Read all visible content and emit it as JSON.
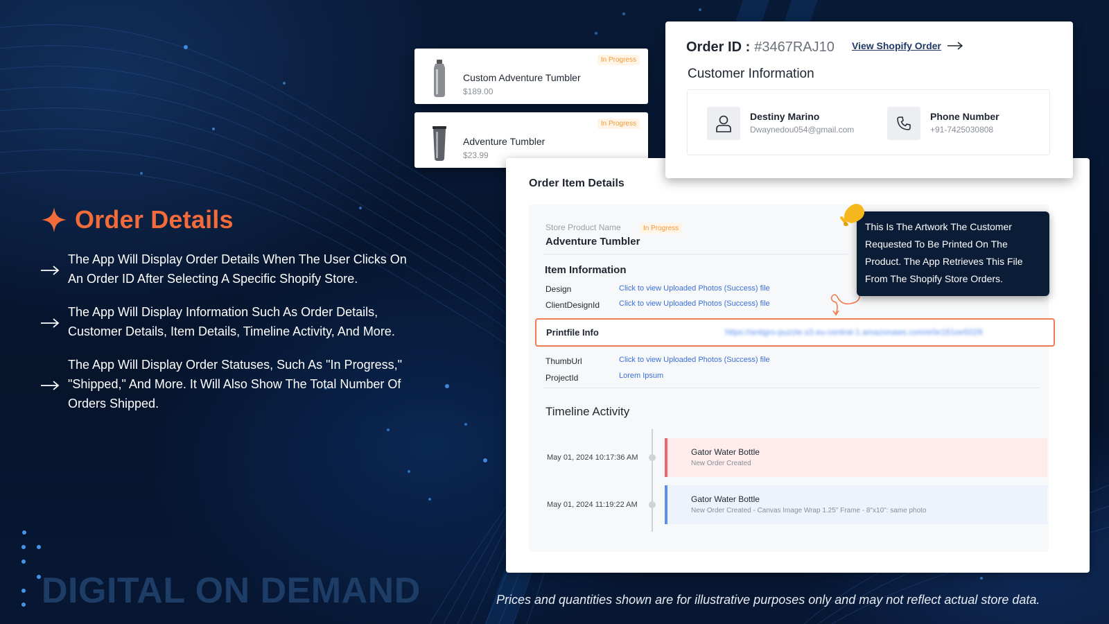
{
  "left_panel": {
    "title": "Order Details",
    "bullets": [
      "The App Will Display Order Details When The User Clicks On An Order ID After Selecting A Specific Shopify Store.",
      "The App Will Display Information Such As Order Details, Customer Details, Item Details, Timeline Activity, And More.",
      "The App Will Display Order Statuses, Such As \"In Progress,\" \"Shipped,\" And More. It Will Also Show The Total Number Of Orders Shipped."
    ]
  },
  "brand": "DIGITAL ON DEMAND",
  "disclaimer": "Prices and quantities shown are for illustrative purposes only and may not reflect actual store data.",
  "products": [
    {
      "name": "Custom Adventure Tumbler",
      "price": "$189.00",
      "status": "In Progress"
    },
    {
      "name": "Adventure Tumbler",
      "price": "$23.99",
      "status": "In Progress"
    }
  ],
  "order": {
    "id_label": "Order ID :",
    "id_value": "#3467RAJ10",
    "view_link": "View Shopify Order",
    "customer_title": "Customer Information",
    "customer_name": "Destiny Marino",
    "customer_email": "Dwaynedou054@gmail.com",
    "phone_label": "Phone Number",
    "phone_value": "+91-7425030808"
  },
  "details": {
    "title": "Order Item Details",
    "store_product_label": "Store Product Name",
    "store_product_status": "In Progress",
    "store_product_name": "Adventure Tumbler",
    "item_info_title": "Item Information",
    "rows_top": [
      {
        "label": "Design",
        "value": "Click to view Uploaded Photos (Success) file"
      },
      {
        "label": "ClientDesignId",
        "value": "Click to view Uploaded Photos (Success) file"
      }
    ],
    "printfile_label": "Printfile Info",
    "printfile_url": "https://antigro-puzzle.s3.eu-central-1.amazonaws.com/e0e161ee5029",
    "rows_bottom": [
      {
        "label": "ThumbUrl",
        "value": "Click to view Uploaded Photos (Success) file"
      },
      {
        "label": "ProjectId",
        "value": "Lorem Ipsum"
      }
    ],
    "timeline_title": "Timeline Activity",
    "timeline": [
      {
        "date": "May 01, 2024 10:17:36 AM",
        "name": "Gator Water Bottle",
        "desc": "New Order Created",
        "color": "#fdeceb",
        "accent": "#f0656a"
      },
      {
        "date": "May 01, 2024 11:19:22 AM",
        "name": "Gator Water Bottle",
        "desc": "New Order Created - Canvas Image Wrap 1.25\" Frame - 8\"x10\": same photo",
        "color": "#edf2fc",
        "accent": "#5b8def"
      }
    ]
  },
  "tooltip": "This Is The Artwork The Customer Requested To Be Printed On The Product. The App Retrieves This File From The Shopify Store Orders.",
  "colors": {
    "accent_orange": "#f26b3a",
    "link_blue": "#3a6fd8",
    "background_navy": "#06152e"
  }
}
